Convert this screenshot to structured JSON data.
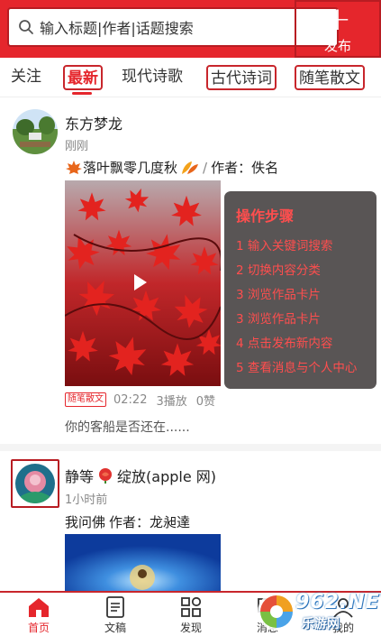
{
  "header": {
    "search_placeholder": "输入标题|作者|话题搜索",
    "publish_label": "发布",
    "publish_icon": "plus-icon"
  },
  "tabs": [
    {
      "label": "关注"
    },
    {
      "label": "最新",
      "active": true
    },
    {
      "label": "现代诗歌"
    },
    {
      "label": "古代诗词"
    },
    {
      "label": "随笔散文"
    }
  ],
  "posts": [
    {
      "author": "东方梦龙",
      "time": "刚刚",
      "title": "落叶飘零几度秋",
      "author_label": "作者：佚名",
      "category": "随笔散文",
      "duration": "02:22",
      "plays": "3播放",
      "likes": "0赞",
      "excerpt": "你的客船是否还在......"
    },
    {
      "author": "静等",
      "author_suffix": "绽放(apple 网)",
      "time": "1小时前",
      "title": "我问佛",
      "author_label": "作者：龙昶達"
    }
  ],
  "steps": {
    "title": "操作步骤",
    "items": [
      "1 输入关键词搜索",
      "2 切换内容分类",
      "3 浏览作品卡片",
      "3 浏览作品卡片",
      "4 点击发布新内容",
      "5 查看消息与个人中心"
    ]
  },
  "bottom_nav": [
    {
      "label": "首页",
      "icon": "home-icon",
      "active": true
    },
    {
      "label": "文稿",
      "icon": "document-icon"
    },
    {
      "label": "发现",
      "icon": "grid-icon"
    },
    {
      "label": "消息",
      "icon": "message-icon"
    },
    {
      "label": "我的",
      "icon": "user-icon"
    }
  ],
  "watermark": {
    "number": "962.NET",
    "site": "乐游网"
  },
  "colors": {
    "brand_red": "#e5262c",
    "steps_text": "#ff4e4e"
  }
}
